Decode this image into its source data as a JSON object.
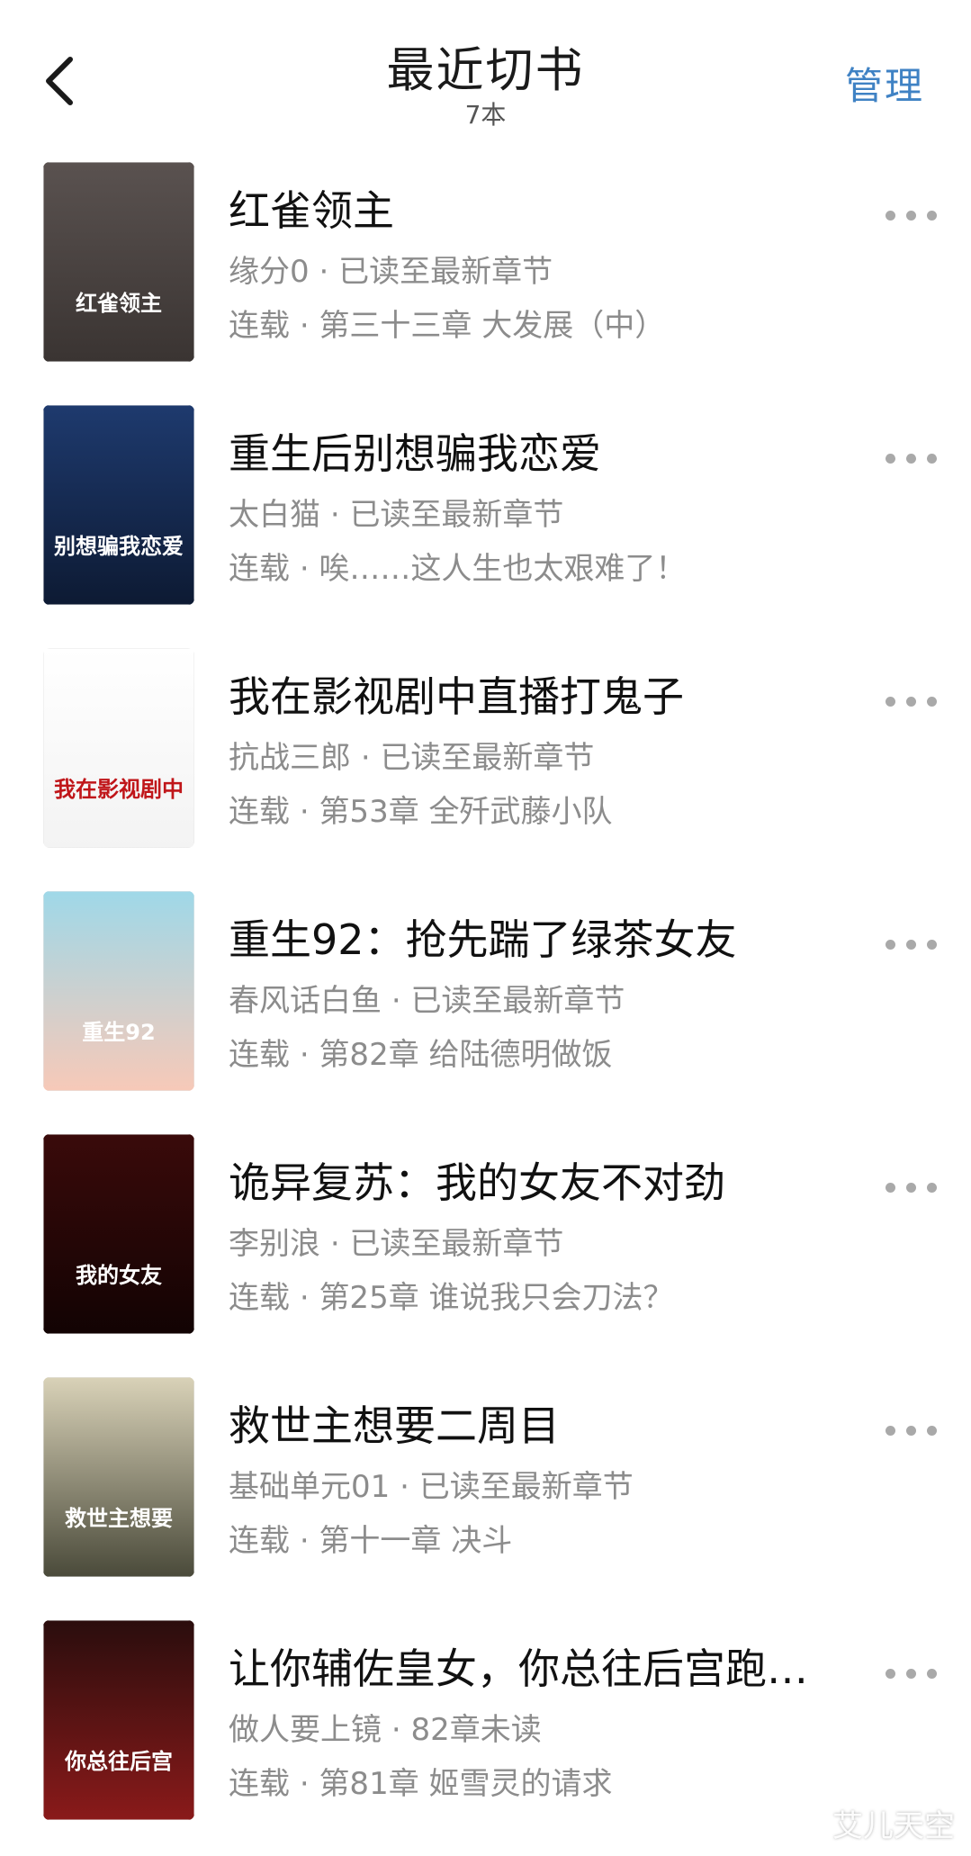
{
  "header": {
    "title": "最近切书",
    "count": "7本",
    "manage_label": "管理"
  },
  "books": [
    {
      "title": "红雀领主",
      "author": "缘分0",
      "progress": "已读至最新章节",
      "status": "连载",
      "chapter": "第三十三章 大发展（中）",
      "cover_title": "红雀领主",
      "cover_colors": [
        "#5a5250",
        "#3a3432"
      ]
    },
    {
      "title": "重生后别想骗我恋爱",
      "author": "太白猫",
      "progress": "已读至最新章节",
      "status": "连载",
      "chapter": "唉……这人生也太艰难了！",
      "cover_title": "别想骗我恋爱",
      "cover_colors": [
        "#1e3a6e",
        "#0d1a33"
      ]
    },
    {
      "title": "我在影视剧中直播打鬼子",
      "author": "抗战三郎",
      "progress": "已读至最新章节",
      "status": "连载",
      "chapter": "第53章 全歼武藤小队",
      "cover_title": "我在影视剧中",
      "cover_colors": [
        "#ffffff",
        "#f3f3f3"
      ]
    },
    {
      "title": "重生92：抢先踹了绿茶女友",
      "author": "春风话白鱼",
      "progress": "已读至最新章节",
      "status": "连载",
      "chapter": "第82章 给陆德明做饭",
      "cover_title": "重生92",
      "cover_colors": [
        "#9fd8e8",
        "#f7c9b8"
      ]
    },
    {
      "title": "诡异复苏：我的女友不对劲",
      "author": "李别浪",
      "progress": "已读至最新章节",
      "status": "连载",
      "chapter": "第25章 谁说我只会刀法？",
      "cover_title": "我的女友",
      "cover_colors": [
        "#3a0a0a",
        "#120303"
      ]
    },
    {
      "title": "救世主想要二周目",
      "author": "基础单元01",
      "progress": "已读至最新章节",
      "status": "连载",
      "chapter": "第十一章 决斗",
      "cover_title": "救世主想要",
      "cover_colors": [
        "#d9d2b8",
        "#4a4a3a"
      ]
    },
    {
      "title": "让你辅佐皇女，你总往后宫跑…",
      "author": "做人要上镜",
      "progress": "82章未读",
      "status": "连载",
      "chapter": "第81章 姬雪灵的请求",
      "cover_title": "你总往后宫",
      "cover_colors": [
        "#2a0d0d",
        "#8a1a1a"
      ]
    }
  ],
  "separator": "·",
  "watermark": "艾儿天空"
}
